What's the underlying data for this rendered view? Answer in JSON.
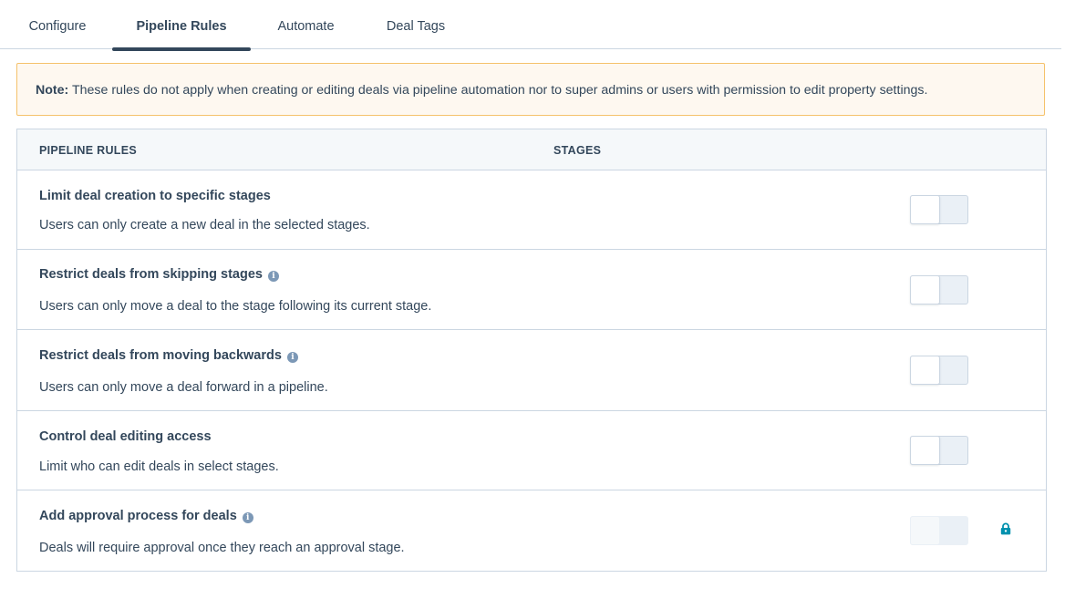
{
  "tabs": [
    {
      "label": "Configure",
      "active": false
    },
    {
      "label": "Pipeline Rules",
      "active": true
    },
    {
      "label": "Automate",
      "active": false
    },
    {
      "label": "Deal Tags",
      "active": false
    }
  ],
  "note": {
    "label": "Note:",
    "text": "These rules do not apply when creating or editing deals via pipeline automation nor to super admins or users with permission to edit property settings."
  },
  "table": {
    "headers": {
      "rules": "PIPELINE RULES",
      "stages": "STAGES"
    },
    "rows": [
      {
        "title": "Limit deal creation to specific stages",
        "description": "Users can only create a new deal in the selected stages.",
        "info": false,
        "enabled": false,
        "locked": false
      },
      {
        "title": "Restrict deals from skipping stages",
        "description": "Users can only move a deal to the stage following its current stage.",
        "info": true,
        "enabled": false,
        "locked": false
      },
      {
        "title": "Restrict deals from moving backwards",
        "description": "Users can only move a deal forward in a pipeline.",
        "info": true,
        "enabled": false,
        "locked": false
      },
      {
        "title": "Control deal editing access",
        "description": "Limit who can edit deals in select stages.",
        "info": false,
        "enabled": false,
        "locked": false
      },
      {
        "title": "Add approval process for deals",
        "description": "Deals will require approval once they reach an approval stage.",
        "info": true,
        "enabled": false,
        "locked": true
      }
    ]
  },
  "colors": {
    "text": "#33475b",
    "border": "#cbd6e2",
    "note_bg": "#fef8f0",
    "note_border": "#f5c26b",
    "lock": "#0091ae"
  }
}
